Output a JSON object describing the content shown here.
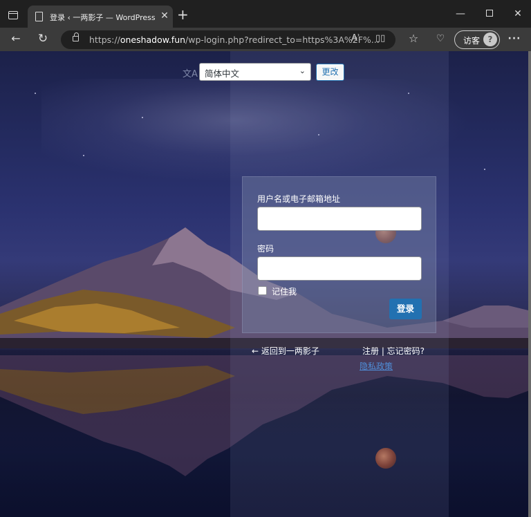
{
  "browser": {
    "tab": {
      "title": "登录 ‹ 一两影子 — WordPress",
      "close": "✕"
    },
    "new_tab": "+",
    "window": {
      "minimize": "—",
      "close": "✕"
    },
    "toolbar": {
      "back": "←",
      "refresh": "↻",
      "url_prefix": "https://",
      "url_host": "oneshadow.fun",
      "url_rest": "/wp-login.php?redirect_to=https%3A%2F%...",
      "read_aloud": "Aʾ",
      "favorites": "☆",
      "health": "♡",
      "guest_label": "访客",
      "guest_avatar": "?",
      "more": "···"
    }
  },
  "language_switcher": {
    "icon": "文A",
    "selected": "简体中文",
    "arrow": "⌄",
    "submit": "更改"
  },
  "login": {
    "username_label": "用户名或电子邮箱地址",
    "username_value": "",
    "password_label": "密码",
    "password_value": "",
    "remember_label": "记住我",
    "remember_checked": false,
    "submit_label": "登录"
  },
  "links": {
    "back": "← 返回到一两影子",
    "register_lost": "注册 | 忘记密码?",
    "privacy": "隐私政策"
  },
  "colors": {
    "primary": "#2271b1",
    "link": "#4f8ed8"
  }
}
